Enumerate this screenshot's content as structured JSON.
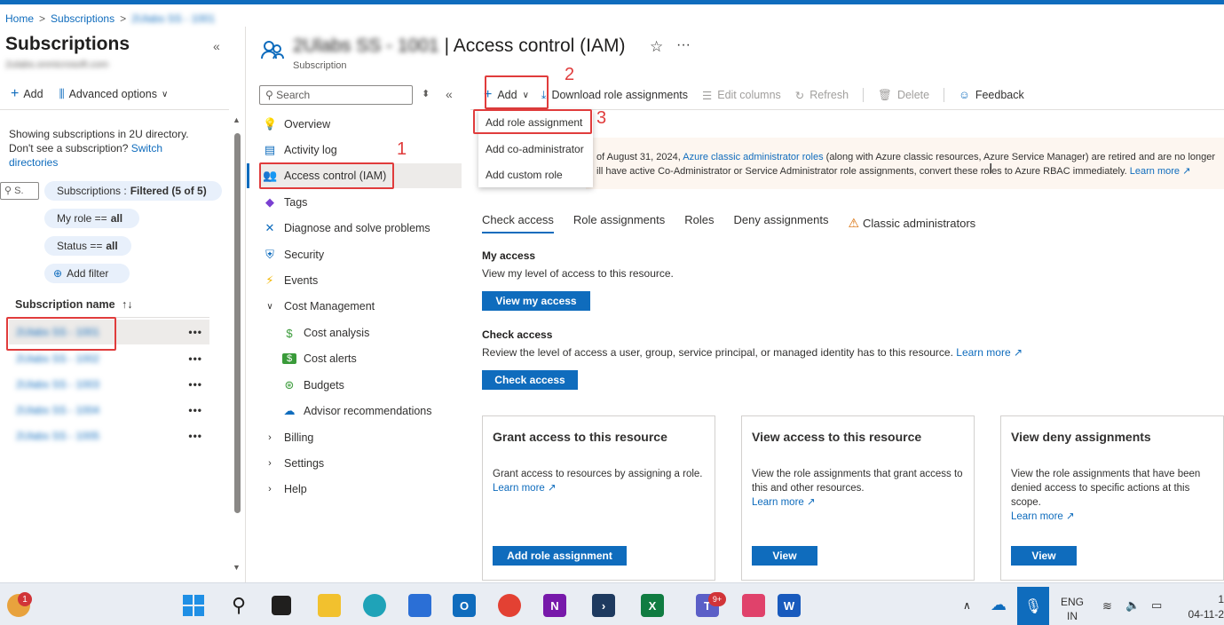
{
  "breadcrumb": {
    "home": "Home",
    "subscriptions": "Subscriptions",
    "current": "2Ulabs SS - 1001",
    "sep": ">"
  },
  "left": {
    "title": "Subscriptions",
    "subtitle": "2ulabs.onmicrosoft.com",
    "add": "Add",
    "advanced": "Advanced options",
    "info_line1": "Showing subscriptions in 2U directory.",
    "info_line2": "Don't see a subscription?",
    "switch": "Switch",
    "directories": "directories",
    "search_placeholder": "S.",
    "filter_subs_label": "Subscriptions :",
    "filter_subs_value": "Filtered (5 of 5)",
    "filter_role_label": "My role ==",
    "filter_role_value": "all",
    "filter_status_label": "Status ==",
    "filter_status_value": "all",
    "add_filter": "Add filter",
    "col_header": "Subscription name",
    "sort": "↑↓",
    "subs": [
      "2Ulabs SS - 1001",
      "2Ulabs SS - 1002",
      "2Ulabs SS - 1003",
      "2Ulabs SS - 1004",
      "2Ulabs SS - 1005"
    ],
    "more": "•••"
  },
  "resource": {
    "name": "2Ulabs SS - 1001",
    "title": "| Access control (IAM)",
    "type": "Subscription",
    "star": "☆",
    "ellipsis": "···"
  },
  "nav": {
    "search_placeholder": "Search",
    "items": [
      "Overview",
      "Activity log",
      "Access control (IAM)",
      "Tags",
      "Diagnose and solve problems",
      "Security",
      "Events",
      "Cost Management",
      "Cost analysis",
      "Cost alerts",
      "Budgets",
      "Advisor recommendations",
      "Billing",
      "Settings",
      "Help"
    ]
  },
  "toolbar": {
    "add": "Add",
    "download": "Download role assignments",
    "edit_columns": "Edit columns",
    "refresh": "Refresh",
    "delete": "Delete",
    "feedback": "Feedback"
  },
  "dropdown": {
    "items": [
      "Add role assignment",
      "Add co-administrator",
      "Add custom role"
    ]
  },
  "annotations": {
    "one": "1",
    "two": "2",
    "three": "3"
  },
  "banner": {
    "line1a": "of August 31, 2024,",
    "link1": "Azure classic administrator roles",
    "line1b": "(along with Azure classic resources, Azure Service Manager) are retired and are no longer",
    "line2": "ill have active Co-Administrator or Service Administrator role assignments, convert these roles to Azure RBAC immediately.",
    "learn": "Learn more"
  },
  "tabs": [
    "Check access",
    "Role assignments",
    "Roles",
    "Deny assignments",
    "Classic administrators"
  ],
  "my_access": {
    "title": "My access",
    "desc": "View my level of access to this resource.",
    "button": "View my access"
  },
  "check_access": {
    "title": "Check access",
    "desc": "Review the level of access a user, group, service principal, or managed identity has to this resource.",
    "learn": "Learn more",
    "button": "Check access"
  },
  "cards": [
    {
      "title": "Grant access to this resource",
      "desc": "Grant access to resources by assigning a role.",
      "learn": "Learn more",
      "button": "Add role assignment"
    },
    {
      "title": "View access to this resource",
      "desc": "View the role assignments that grant access to this and other resources.",
      "learn": "Learn more",
      "button": "View"
    },
    {
      "title": "View deny assignments",
      "desc": "View the role assignments that have been denied access to specific actions at this scope.",
      "learn": "Learn more",
      "button": "View"
    }
  ],
  "taskbar": {
    "lang1": "ENG",
    "lang2": "IN",
    "time": "1",
    "date": "04-11-2",
    "badge1": "1",
    "badge_teams": "9+",
    "icons": [
      "start-icon",
      "search-icon",
      "task-view-icon",
      "file-explorer-icon",
      "edge-icon",
      "store-icon",
      "outlook-icon",
      "chrome-icon",
      "onenote-icon",
      "terminal-icon",
      "excel-icon",
      "teams-icon",
      "snipping-tool-icon",
      "word-icon"
    ]
  },
  "colors": {
    "accent": "#0f6cbd",
    "annotation": "#e03c3c",
    "banner_bg": "#fdf6f0"
  }
}
